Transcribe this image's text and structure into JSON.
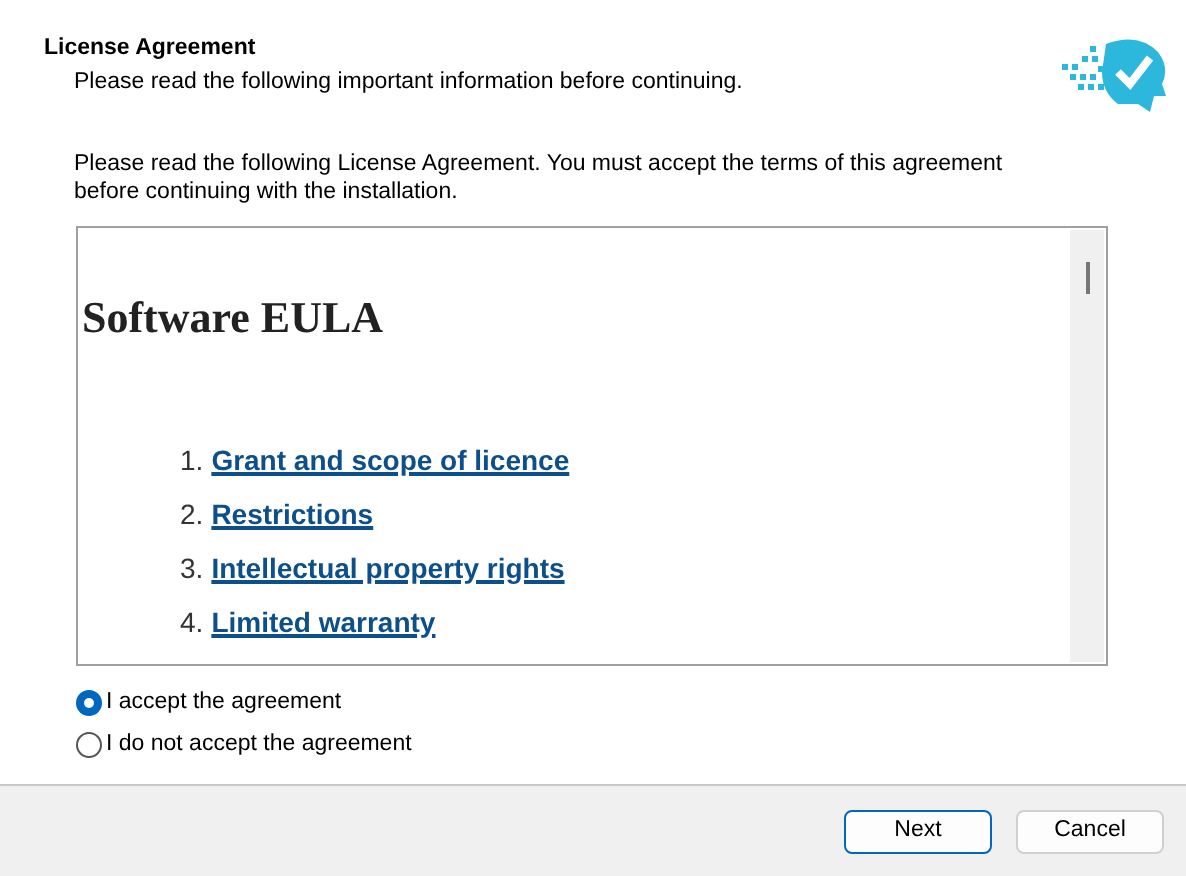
{
  "header": {
    "title": "License Agreement",
    "subtitle": "Please read the following important information before continuing."
  },
  "intro": "Please read the following License Agreement. You must accept the terms of this agreement before continuing with the installation.",
  "license": {
    "heading": "Software EULA",
    "items": [
      {
        "number": "1.",
        "text": "Grant and scope of licence"
      },
      {
        "number": "2.",
        "text": "Restrictions"
      },
      {
        "number": "3.",
        "text": "Intellectual property rights"
      },
      {
        "number": "4.",
        "text": "Limited warranty"
      }
    ]
  },
  "options": [
    {
      "label": "I accept the agreement",
      "selected": true
    },
    {
      "label": "I do not accept the agreement",
      "selected": false
    }
  ],
  "buttons": [
    {
      "label": "Next",
      "kind": "default"
    },
    {
      "label": "Cancel",
      "kind": "normal"
    }
  ]
}
